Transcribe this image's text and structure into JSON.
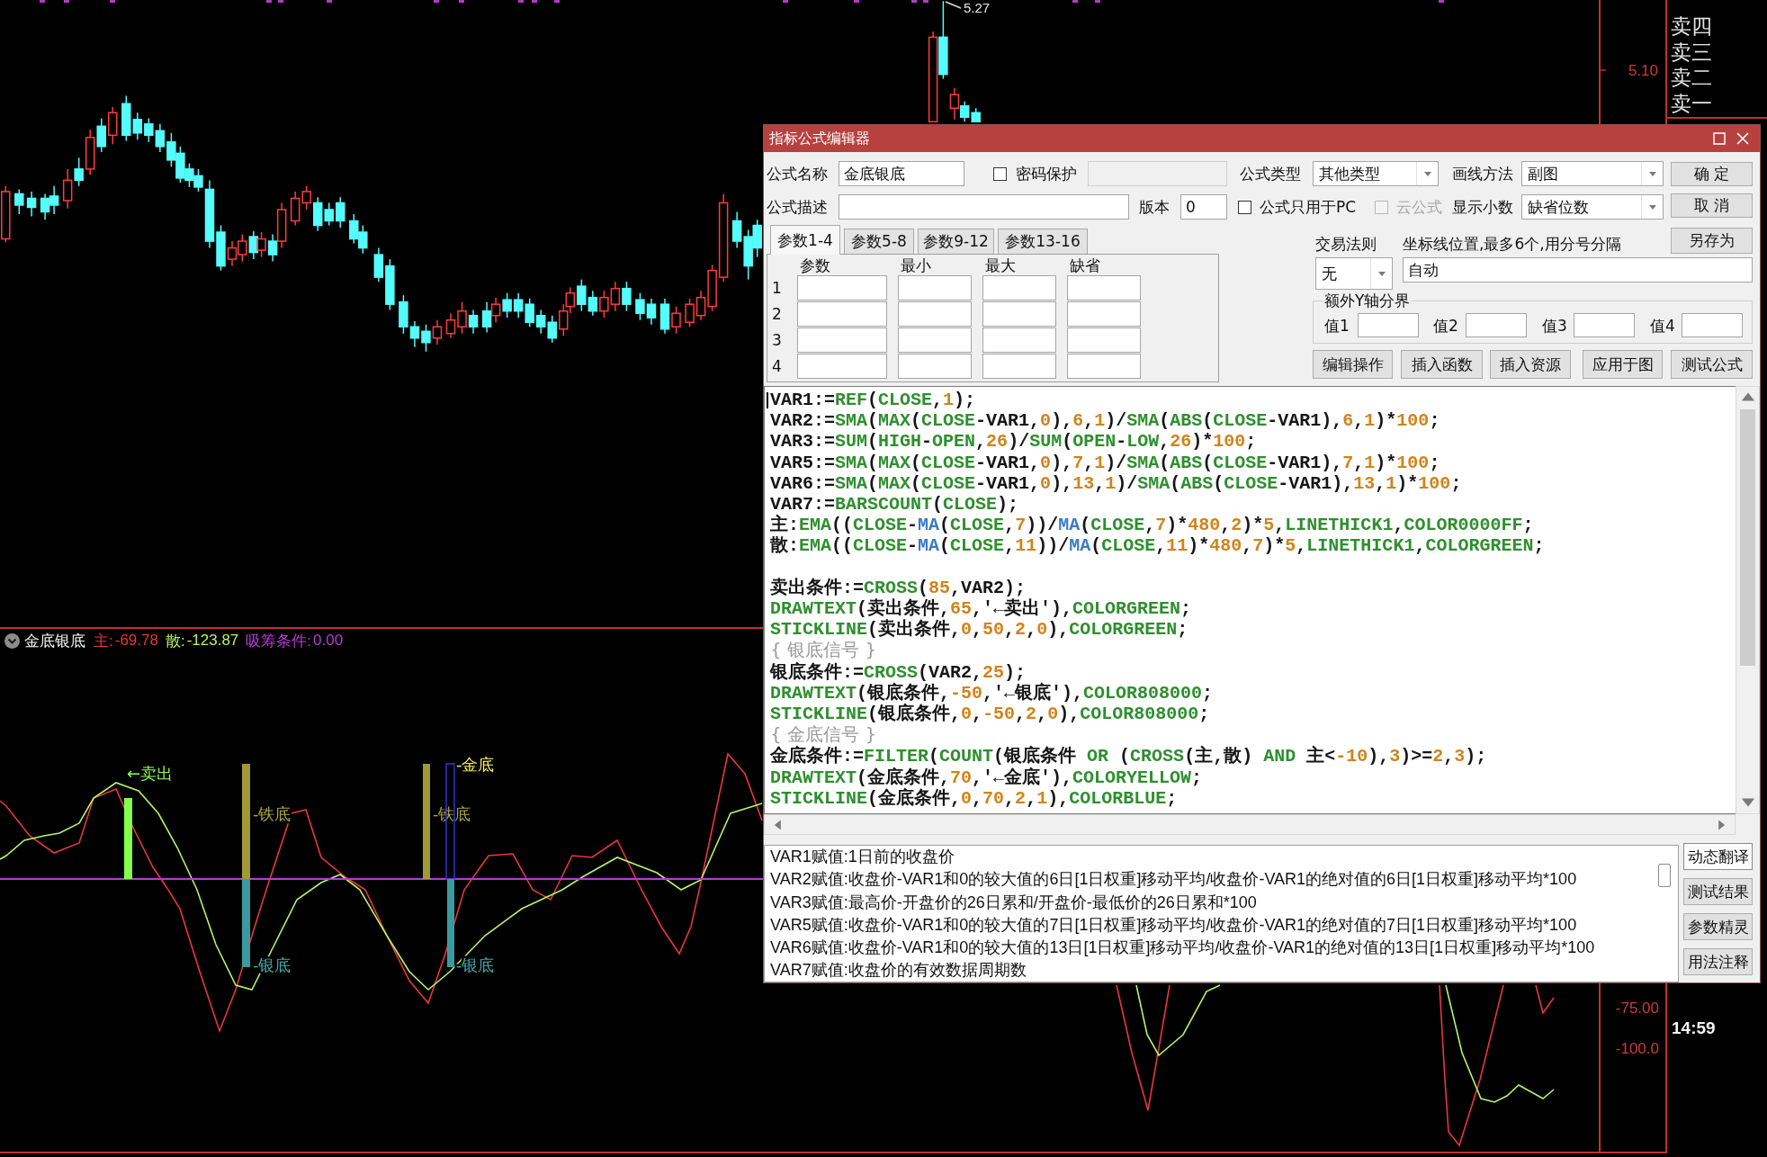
{
  "price_chart": {
    "high_label": "5.27",
    "axis_labels": [
      "5.10"
    ]
  },
  "order_book": {
    "rows": [
      "卖四",
      "卖三",
      "卖二",
      "卖一"
    ]
  },
  "dialog": {
    "title": "指标公式编辑器",
    "name": {
      "label": "公式名称",
      "value": "金底银底"
    },
    "password": {
      "label": "密码保护",
      "checked": false,
      "field_disabled": true
    },
    "formula_type": {
      "label": "公式类型",
      "value": "其他类型"
    },
    "draw_method": {
      "label": "画线方法",
      "value": "副图"
    },
    "description": {
      "label": "公式描述"
    },
    "version": {
      "label": "版本",
      "value": "0"
    },
    "pc_only": {
      "label": "公式只用于PC",
      "checked": false,
      "disabled": false
    },
    "cloud": {
      "label": "云公式",
      "checked": false,
      "disabled": true
    },
    "decimals": {
      "label": "显示小数",
      "value": "缺省位数"
    },
    "actions": [
      "确 定",
      "取 消",
      "另存为"
    ],
    "param_tabs": [
      {
        "label": "参数1-4",
        "selected": true
      },
      {
        "label": "参数5-8",
        "selected": false
      },
      {
        "label": "参数9-12",
        "selected": false
      },
      {
        "label": "参数13-16",
        "selected": false
      }
    ],
    "param_table": {
      "columns": [
        "参数",
        "最小",
        "最大",
        "缺省"
      ],
      "rows": [
        "1",
        "2",
        "3",
        "4"
      ]
    },
    "trade_rule": {
      "label": "交易法则",
      "value": "无"
    },
    "axis_lines": {
      "label": "坐标线位置,最多6个,用分号分隔",
      "value": "自动"
    },
    "y_bounds": {
      "title": "额外Y轴分界",
      "fields": [
        "值1",
        "值2",
        "值3",
        "值4"
      ]
    },
    "tools": [
      "编辑操作",
      "插入函数",
      "插入资源",
      "应用于图",
      "测试公式"
    ],
    "code": {
      "blocks": [
        [
          [
            {
              "kind": "plain",
              "text": "VAR1:="
            },
            {
              "kind": "func",
              "text": "REF"
            },
            {
              "kind": "plain",
              "text": "("
            },
            {
              "kind": "func",
              "text": "CLOSE"
            },
            {
              "kind": "plain",
              "text": ","
            },
            {
              "kind": "num",
              "text": "1"
            },
            {
              "kind": "plain",
              "text": ");"
            }
          ],
          [
            {
              "kind": "plain",
              "text": "VAR2:="
            },
            {
              "kind": "func",
              "text": "SMA"
            },
            {
              "kind": "plain",
              "text": "("
            },
            {
              "kind": "func",
              "text": "MAX"
            },
            {
              "kind": "plain",
              "text": "("
            },
            {
              "kind": "func",
              "text": "CLOSE"
            },
            {
              "kind": "plain",
              "text": "-VAR1,"
            },
            {
              "kind": "num",
              "text": "0"
            },
            {
              "kind": "plain",
              "text": "),"
            },
            {
              "kind": "num",
              "text": "6"
            },
            {
              "kind": "plain",
              "text": ","
            },
            {
              "kind": "num",
              "text": "1"
            },
            {
              "kind": "plain",
              "text": ")/"
            },
            {
              "kind": "func",
              "text": "SMA"
            },
            {
              "kind": "plain",
              "text": "("
            },
            {
              "kind": "func",
              "text": "ABS"
            },
            {
              "kind": "plain",
              "text": "("
            },
            {
              "kind": "func",
              "text": "CLOSE"
            },
            {
              "kind": "plain",
              "text": "-VAR1),"
            },
            {
              "kind": "num",
              "text": "6"
            },
            {
              "kind": "plain",
              "text": ","
            },
            {
              "kind": "num",
              "text": "1"
            },
            {
              "kind": "plain",
              "text": ")*"
            },
            {
              "kind": "num",
              "text": "100"
            },
            {
              "kind": "plain",
              "text": ";"
            }
          ],
          [
            {
              "kind": "plain",
              "text": "VAR3:="
            },
            {
              "kind": "func",
              "text": "SUM"
            },
            {
              "kind": "plain",
              "text": "("
            },
            {
              "kind": "func",
              "text": "HIGH"
            },
            {
              "kind": "plain",
              "text": "-"
            },
            {
              "kind": "func",
              "text": "OPEN"
            },
            {
              "kind": "plain",
              "text": ","
            },
            {
              "kind": "num",
              "text": "26"
            },
            {
              "kind": "plain",
              "text": ")/"
            },
            {
              "kind": "func",
              "text": "SUM"
            },
            {
              "kind": "plain",
              "text": "("
            },
            {
              "kind": "func",
              "text": "OPEN"
            },
            {
              "kind": "plain",
              "text": "-"
            },
            {
              "kind": "func",
              "text": "LOW"
            },
            {
              "kind": "plain",
              "text": ","
            },
            {
              "kind": "num",
              "text": "26"
            },
            {
              "kind": "plain",
              "text": ")*"
            },
            {
              "kind": "num",
              "text": "100"
            },
            {
              "kind": "plain",
              "text": ";"
            }
          ],
          [
            {
              "kind": "plain",
              "text": "VAR5:="
            },
            {
              "kind": "func",
              "text": "SMA"
            },
            {
              "kind": "plain",
              "text": "("
            },
            {
              "kind": "func",
              "text": "MAX"
            },
            {
              "kind": "plain",
              "text": "("
            },
            {
              "kind": "func",
              "text": "CLOSE"
            },
            {
              "kind": "plain",
              "text": "-VAR1,"
            },
            {
              "kind": "num",
              "text": "0"
            },
            {
              "kind": "plain",
              "text": "),"
            },
            {
              "kind": "num",
              "text": "7"
            },
            {
              "kind": "plain",
              "text": ","
            },
            {
              "kind": "num",
              "text": "1"
            },
            {
              "kind": "plain",
              "text": ")/"
            },
            {
              "kind": "func",
              "text": "SMA"
            },
            {
              "kind": "plain",
              "text": "("
            },
            {
              "kind": "func",
              "text": "ABS"
            },
            {
              "kind": "plain",
              "text": "("
            },
            {
              "kind": "func",
              "text": "CLOSE"
            },
            {
              "kind": "plain",
              "text": "-VAR1),"
            },
            {
              "kind": "num",
              "text": "7"
            },
            {
              "kind": "plain",
              "text": ","
            },
            {
              "kind": "num",
              "text": "1"
            },
            {
              "kind": "plain",
              "text": ")*"
            },
            {
              "kind": "num",
              "text": "100"
            },
            {
              "kind": "plain",
              "text": ";"
            }
          ],
          [
            {
              "kind": "plain",
              "text": "VAR6:="
            },
            {
              "kind": "func",
              "text": "SMA"
            },
            {
              "kind": "plain",
              "text": "("
            },
            {
              "kind": "func",
              "text": "MAX"
            },
            {
              "kind": "plain",
              "text": "("
            },
            {
              "kind": "func",
              "text": "CLOSE"
            },
            {
              "kind": "plain",
              "text": "-VAR1,"
            },
            {
              "kind": "num",
              "text": "0"
            },
            {
              "kind": "plain",
              "text": "),"
            },
            {
              "kind": "num",
              "text": "13"
            },
            {
              "kind": "plain",
              "text": ","
            },
            {
              "kind": "num",
              "text": "1"
            },
            {
              "kind": "plain",
              "text": ")/"
            },
            {
              "kind": "func",
              "text": "SMA"
            },
            {
              "kind": "plain",
              "text": "("
            },
            {
              "kind": "func",
              "text": "ABS"
            },
            {
              "kind": "plain",
              "text": "("
            },
            {
              "kind": "func",
              "text": "CLOSE"
            },
            {
              "kind": "plain",
              "text": "-VAR1),"
            },
            {
              "kind": "num",
              "text": "13"
            },
            {
              "kind": "plain",
              "text": ","
            },
            {
              "kind": "num",
              "text": "1"
            },
            {
              "kind": "plain",
              "text": ")*"
            },
            {
              "kind": "num",
              "text": "100"
            },
            {
              "kind": "plain",
              "text": ";"
            }
          ],
          [
            {
              "kind": "plain",
              "text": "VAR7:="
            },
            {
              "kind": "func",
              "text": "BARSCOUNT"
            },
            {
              "kind": "plain",
              "text": "("
            },
            {
              "kind": "func",
              "text": "CLOSE"
            },
            {
              "kind": "plain",
              "text": ");"
            }
          ],
          [
            {
              "kind": "plain",
              "text": "主:"
            },
            {
              "kind": "func",
              "text": "EMA"
            },
            {
              "kind": "plain",
              "text": "(("
            },
            {
              "kind": "func",
              "text": "CLOSE"
            },
            {
              "kind": "plain",
              "text": "-"
            },
            {
              "kind": "builtin",
              "text": "MA"
            },
            {
              "kind": "plain",
              "text": "("
            },
            {
              "kind": "func",
              "text": "CLOSE"
            },
            {
              "kind": "plain",
              "text": ","
            },
            {
              "kind": "num",
              "text": "7"
            },
            {
              "kind": "plain",
              "text": "))/"
            },
            {
              "kind": "builtin",
              "text": "MA"
            },
            {
              "kind": "plain",
              "text": "("
            },
            {
              "kind": "func",
              "text": "CLOSE"
            },
            {
              "kind": "plain",
              "text": ","
            },
            {
              "kind": "num",
              "text": "7"
            },
            {
              "kind": "plain",
              "text": ")*"
            },
            {
              "kind": "num",
              "text": "480"
            },
            {
              "kind": "plain",
              "text": ","
            },
            {
              "kind": "num",
              "text": "2"
            },
            {
              "kind": "plain",
              "text": ")*"
            },
            {
              "kind": "num",
              "text": "5"
            },
            {
              "kind": "plain",
              "text": ","
            },
            {
              "kind": "func",
              "text": "LINETHICK1"
            },
            {
              "kind": "plain",
              "text": ","
            },
            {
              "kind": "func",
              "text": "COLOR0000FF"
            },
            {
              "kind": "plain",
              "text": ";"
            }
          ],
          [
            {
              "kind": "plain",
              "text": "散:"
            },
            {
              "kind": "func",
              "text": "EMA"
            },
            {
              "kind": "plain",
              "text": "(("
            },
            {
              "kind": "func",
              "text": "CLOSE"
            },
            {
              "kind": "plain",
              "text": "-"
            },
            {
              "kind": "builtin",
              "text": "MA"
            },
            {
              "kind": "plain",
              "text": "("
            },
            {
              "kind": "func",
              "text": "CLOSE"
            },
            {
              "kind": "plain",
              "text": ","
            },
            {
              "kind": "num",
              "text": "11"
            },
            {
              "kind": "plain",
              "text": "))/"
            },
            {
              "kind": "builtin",
              "text": "MA"
            },
            {
              "kind": "plain",
              "text": "("
            },
            {
              "kind": "func",
              "text": "CLOSE"
            },
            {
              "kind": "plain",
              "text": ","
            },
            {
              "kind": "num",
              "text": "11"
            },
            {
              "kind": "plain",
              "text": ")*"
            },
            {
              "kind": "num",
              "text": "480"
            },
            {
              "kind": "plain",
              "text": ","
            },
            {
              "kind": "num",
              "text": "7"
            },
            {
              "kind": "plain",
              "text": ")*"
            },
            {
              "kind": "num",
              "text": "5"
            },
            {
              "kind": "plain",
              "text": ","
            },
            {
              "kind": "func",
              "text": "LINETHICK1"
            },
            {
              "kind": "plain",
              "text": ","
            },
            {
              "kind": "func",
              "text": "COLORGREEN"
            },
            {
              "kind": "plain",
              "text": ";"
            }
          ]
        ],
        [
          [
            {
              "kind": "plain",
              "text": "卖出条件:="
            },
            {
              "kind": "func",
              "text": "CROSS"
            },
            {
              "kind": "plain",
              "text": "("
            },
            {
              "kind": "num",
              "text": "85"
            },
            {
              "kind": "plain",
              "text": ",VAR2);"
            }
          ],
          [
            {
              "kind": "func",
              "text": "DRAWTEXT"
            },
            {
              "kind": "plain",
              "text": "(卖出条件,"
            },
            {
              "kind": "num",
              "text": "65"
            },
            {
              "kind": "plain",
              "text": ",'←卖出'),"
            },
            {
              "kind": "func",
              "text": "COLORGREEN"
            },
            {
              "kind": "plain",
              "text": ";"
            }
          ],
          [
            {
              "kind": "func",
              "text": "STICKLINE"
            },
            {
              "kind": "plain",
              "text": "(卖出条件,"
            },
            {
              "kind": "num",
              "text": "0"
            },
            {
              "kind": "plain",
              "text": ","
            },
            {
              "kind": "num",
              "text": "50"
            },
            {
              "kind": "plain",
              "text": ","
            },
            {
              "kind": "num",
              "text": "2"
            },
            {
              "kind": "plain",
              "text": ","
            },
            {
              "kind": "num",
              "text": "0"
            },
            {
              "kind": "plain",
              "text": "),"
            },
            {
              "kind": "func",
              "text": "COLORGREEN"
            },
            {
              "kind": "plain",
              "text": ";"
            }
          ],
          [
            {
              "kind": "note",
              "text": "{ 银底信号 }"
            }
          ],
          [
            {
              "kind": "plain",
              "text": "银底条件:="
            },
            {
              "kind": "func",
              "text": "CROSS"
            },
            {
              "kind": "plain",
              "text": "(VAR2,"
            },
            {
              "kind": "num",
              "text": "25"
            },
            {
              "kind": "plain",
              "text": ");"
            }
          ],
          [
            {
              "kind": "func",
              "text": "DRAWTEXT"
            },
            {
              "kind": "plain",
              "text": "(银底条件,"
            },
            {
              "kind": "num",
              "text": "-50"
            },
            {
              "kind": "plain",
              "text": ",'←银底'),"
            },
            {
              "kind": "func",
              "text": "COLOR808000"
            },
            {
              "kind": "plain",
              "text": ";"
            }
          ],
          [
            {
              "kind": "func",
              "text": "STICKLINE"
            },
            {
              "kind": "plain",
              "text": "(银底条件,"
            },
            {
              "kind": "num",
              "text": "0"
            },
            {
              "kind": "plain",
              "text": ","
            },
            {
              "kind": "num",
              "text": "-50"
            },
            {
              "kind": "plain",
              "text": ","
            },
            {
              "kind": "num",
              "text": "2"
            },
            {
              "kind": "plain",
              "text": ","
            },
            {
              "kind": "num",
              "text": "0"
            },
            {
              "kind": "plain",
              "text": "),"
            },
            {
              "kind": "func",
              "text": "COLOR808000"
            },
            {
              "kind": "plain",
              "text": ";"
            }
          ],
          [
            {
              "kind": "note",
              "text": "{ 金底信号 }"
            }
          ],
          [
            {
              "kind": "plain",
              "text": "金底条件:="
            },
            {
              "kind": "func",
              "text": "FILTER"
            },
            {
              "kind": "plain",
              "text": "("
            },
            {
              "kind": "func",
              "text": "COUNT"
            },
            {
              "kind": "plain",
              "text": "(银底条件 "
            },
            {
              "kind": "func",
              "text": "OR"
            },
            {
              "kind": "plain",
              "text": " ("
            },
            {
              "kind": "func",
              "text": "CROSS"
            },
            {
              "kind": "plain",
              "text": "(主,散) "
            },
            {
              "kind": "func",
              "text": "AND"
            },
            {
              "kind": "plain",
              "text": " 主<"
            },
            {
              "kind": "num",
              "text": "-10"
            },
            {
              "kind": "plain",
              "text": "),"
            },
            {
              "kind": "num",
              "text": "3"
            },
            {
              "kind": "plain",
              "text": ")>="
            },
            {
              "kind": "num",
              "text": "2"
            },
            {
              "kind": "plain",
              "text": ","
            },
            {
              "kind": "num",
              "text": "3"
            },
            {
              "kind": "plain",
              "text": ");"
            }
          ],
          [
            {
              "kind": "func",
              "text": "DRAWTEXT"
            },
            {
              "kind": "plain",
              "text": "(金底条件,"
            },
            {
              "kind": "num",
              "text": "70"
            },
            {
              "kind": "plain",
              "text": ",'←金底'),"
            },
            {
              "kind": "func",
              "text": "COLORYELLOW"
            },
            {
              "kind": "plain",
              "text": ";"
            }
          ],
          [
            {
              "kind": "func",
              "text": "STICKLINE"
            },
            {
              "kind": "plain",
              "text": "(金底条件,"
            },
            {
              "kind": "num",
              "text": "0"
            },
            {
              "kind": "plain",
              "text": ","
            },
            {
              "kind": "num",
              "text": "70"
            },
            {
              "kind": "plain",
              "text": ","
            },
            {
              "kind": "num",
              "text": "2"
            },
            {
              "kind": "plain",
              "text": ","
            },
            {
              "kind": "num",
              "text": "1"
            },
            {
              "kind": "plain",
              "text": "),"
            },
            {
              "kind": "func",
              "text": "COLORBLUE"
            },
            {
              "kind": "plain",
              "text": ";"
            }
          ]
        ]
      ]
    },
    "notes": [
      "VAR1赋值:1日前的收盘价",
      "VAR2赋值:收盘价-VAR1和0的较大值的6日[1日权重]移动平均/收盘价-VAR1的绝对值的6日[1日权重]移动平均*100",
      "VAR3赋值:最高价-开盘价的26日累和/开盘价-最低价的26日累和*100",
      "VAR5赋值:收盘价-VAR1和0的较大值的7日[1日权重]移动平均/收盘价-VAR1的绝对值的7日[1日权重]移动平均*100",
      "VAR6赋值:收盘价-VAR1和0的较大值的13日[1日权重]移动平均/收盘价-VAR1的绝对值的13日[1日权重]移动平均*100",
      "VAR7赋值:收盘价的有效数据周期数"
    ],
    "side_buttons": [
      {
        "label": "动态翻译",
        "selected": true
      },
      {
        "label": "测试结果",
        "selected": false
      },
      {
        "label": "参数精灵",
        "selected": false
      },
      {
        "label": "用法注释",
        "selected": false
      }
    ]
  },
  "indicator": {
    "title": "金底银底",
    "readings": [
      {
        "label": "主:",
        "value": "-69.78",
        "color": "#e8383a"
      },
      {
        "label": "散:",
        "value": "-123.87",
        "color": "#b4f46a"
      },
      {
        "label": "吸筹条件:",
        "value": "0.00",
        "color": "#b83cd8"
      }
    ],
    "signals": [
      {
        "kind": "sell",
        "label": "←卖出"
      },
      {
        "kind": "iron",
        "label": "-铁底"
      },
      {
        "kind": "silver",
        "label": "-银底"
      },
      {
        "kind": "iron",
        "label": "-铁底"
      },
      {
        "kind": "gold",
        "label": "-金底"
      },
      {
        "kind": "silver",
        "label": "-银底"
      }
    ],
    "axis_labels": [
      "-75.00",
      "-100.0"
    ]
  },
  "clock": "14:59"
}
